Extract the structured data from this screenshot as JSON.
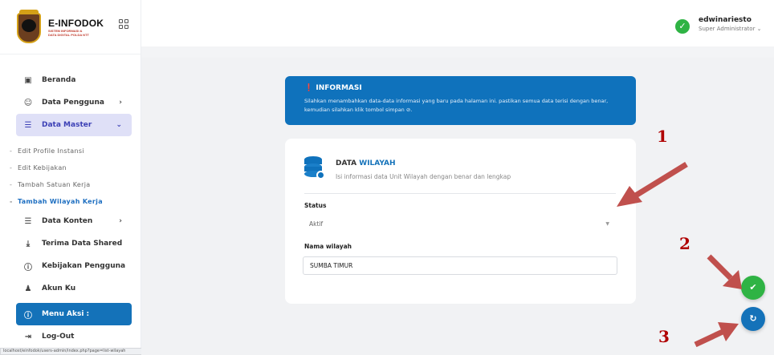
{
  "brand": {
    "title": "E-INFODOK",
    "subtitle_line1": "SISTEM INFORMASI &",
    "subtitle_line2": "DATA DIGITAL POLDA NTT"
  },
  "user": {
    "name": "edwinariesto",
    "role": "Super Administrator ⌄"
  },
  "sidebar": {
    "items": [
      {
        "label": "Beranda",
        "icon": "monitor-icon"
      },
      {
        "label": "Data Pengguna",
        "icon": "users-icon",
        "chevron": "›"
      },
      {
        "label": "Data Master",
        "icon": "database-icon",
        "chevron": "⌄"
      },
      {
        "label": "Data Konten",
        "icon": "layers-icon",
        "chevron": "›"
      },
      {
        "label": "Terima Data Shared",
        "icon": "download-icon"
      },
      {
        "label": "Kebijakan Pengguna",
        "icon": "help-circle-icon"
      },
      {
        "label": "Akun Ku",
        "icon": "user-icon"
      },
      {
        "label": "Menu Aksi :",
        "icon": "info-circle-icon"
      },
      {
        "label": "Log-Out",
        "icon": "logout-icon"
      }
    ],
    "sub_items": [
      "Edit Profile Instansi",
      "Edit Kebijakan",
      "Tambah Satuan Kerja",
      "Tambah Wilayah Kerja"
    ]
  },
  "status_url": "localhost/einfodok/users-admin/index.php?page=list-wilayah",
  "info": {
    "title": "❗ INFORMASI",
    "text": "Silahkan menambahkan data-data informasi yang baru pada halaman ini. pastikan semua data terisi dengan benar, kemudian silahkan klik tombol simpan ⊘."
  },
  "card": {
    "title_prefix": "DATA ",
    "title_highlight": "WILAYAH",
    "subtitle": "Isi informasi data Unit Wilayah dengan benar dan lengkap"
  },
  "form": {
    "status_label": "Status",
    "status_value": "Aktif",
    "nama_label": "Nama wilayah",
    "nama_value": "SUMBA TIMUR"
  },
  "buttons": {
    "save_icon": "✔",
    "reset_icon": "↻"
  },
  "annotations": {
    "n1": "1",
    "n2": "2",
    "n3": "3"
  },
  "colors": {
    "primary": "#1472b9",
    "success": "#2fb344",
    "active_bg": "#dfe0f7",
    "annotation": "#b00000"
  }
}
